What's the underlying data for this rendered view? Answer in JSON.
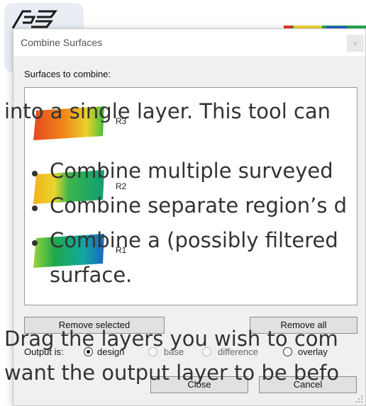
{
  "dialog": {
    "title": "Combine Surfaces",
    "close_glyph": "×",
    "surfaces_label": "Surfaces to combine:",
    "surfaces": [
      {
        "label": "R3"
      },
      {
        "label": "R2"
      },
      {
        "label": "R1"
      }
    ],
    "remove_selected_label": "Remove selected",
    "remove_all_label": "Remove all",
    "output_label": "Output is:",
    "output_options": [
      {
        "label": "design",
        "selected": true
      },
      {
        "label": "base",
        "selected": false
      },
      {
        "label": "difference",
        "selected": false
      },
      {
        "label": "overlay",
        "selected": false
      }
    ],
    "close_label": "Close",
    "cancel_label": "Cancel"
  },
  "help_text": {
    "line1": "into a single layer. This tool can",
    "bullet1": "Combine multiple surveyed",
    "bullet2": "Combine separate region’s d",
    "bullet3": "Combine a (possibly filtered",
    "bullet3_cont": "surface.",
    "line_drag": "Drag the layers you wish to com",
    "line_want": "want the output layer to be befo"
  },
  "colors": {
    "dialog_bg": "#f0f0f0",
    "overlay_text": "#333333"
  }
}
